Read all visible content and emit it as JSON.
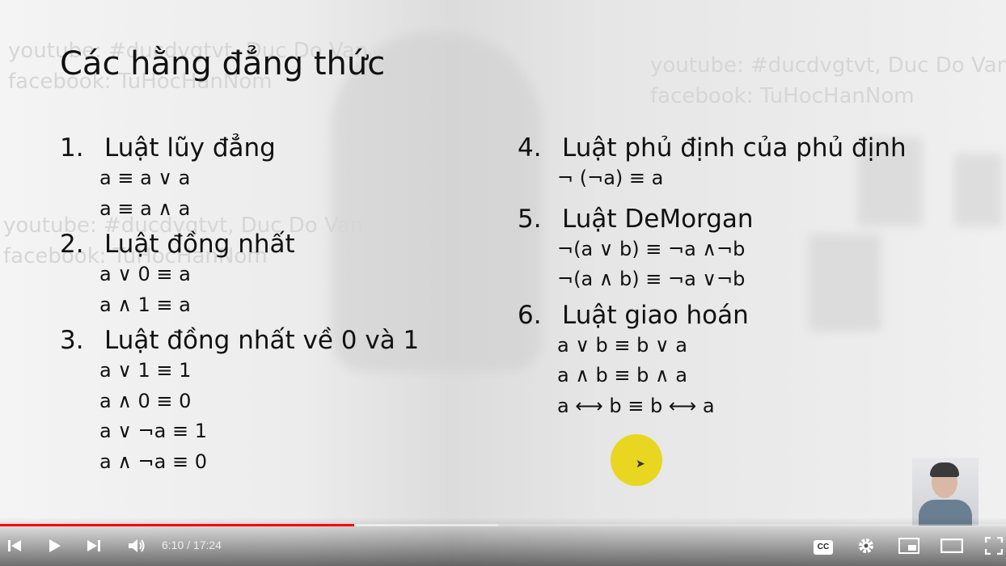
{
  "slide": {
    "title": "Các hằng đẳng thức",
    "watermark": {
      "line1": "youtube: #ducdvgtvt, Duc Do Van",
      "line2": "facebook: TuHocHanNom"
    },
    "left_column": [
      {
        "num": "1.",
        "name": "Luật lũy đẳng",
        "formulas": [
          "a ≡ a ∨ a",
          "a ≡ a ∧ a"
        ]
      },
      {
        "num": "2.",
        "name": "Luật đồng nhất",
        "formulas": [
          "a ∨ 0  ≡  a",
          "a ∧ 1  ≡  a"
        ]
      },
      {
        "num": "3.",
        "name": "Luật đồng nhất về 0 và 1",
        "formulas": [
          "a ∨ 1 ≡  1",
          "a ∧ 0 ≡  0",
          "a ∨ ¬a ≡ 1",
          "a ∧ ¬a ≡  0"
        ]
      }
    ],
    "right_column": [
      {
        "num": "4.",
        "name": "Luật phủ định của phủ định",
        "formulas": [
          "¬ (¬a) ≡ a"
        ]
      },
      {
        "num": "5.",
        "name": "Luật DeMorgan",
        "formulas": [
          "¬(a ∨ b) ≡ ¬a ∧¬b",
          "¬(a ∧ b) ≡ ¬a ∨¬b"
        ]
      },
      {
        "num": "6.",
        "name": "Luật giao hoán",
        "formulas": [
          "a ∨ b ≡ b ∨ a",
          "a ∧ b ≡ b ∧ a",
          "a ⟷ b ≡ b ⟷ a"
        ]
      }
    ]
  },
  "player": {
    "time_display": "6:10 / 17:24",
    "progress": {
      "played_fraction": 0.352,
      "buffered_fraction": 0.495
    },
    "colors": {
      "progress_played": "#ff0000",
      "cursor_highlight": "#e8d620"
    },
    "icons": [
      "previous-icon",
      "play-icon",
      "next-icon",
      "volume-icon",
      "captions-icon",
      "settings-gear-icon",
      "miniplayer-icon",
      "theater-mode-icon",
      "fullscreen-icon"
    ],
    "captions_label": "CC"
  }
}
